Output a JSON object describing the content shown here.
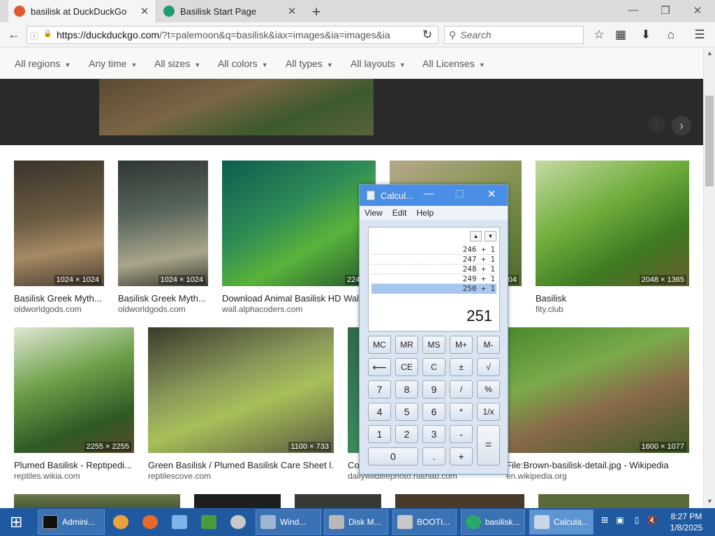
{
  "tabs": [
    {
      "label": "basilisk at DuckDuckGo",
      "close": "✕"
    },
    {
      "label": "Basilisk Start Page",
      "close": "✕"
    }
  ],
  "newtab": "+",
  "window_controls": {
    "minimize": "—",
    "restore": "❐",
    "close": "✕"
  },
  "nav": {
    "back": "←",
    "info": "ⓘ",
    "lock": "🔒",
    "url_host": "https://duckduckgo.com",
    "url_path": "/?t=palemoon&q=basilisk&iax=images&ia=images&ia",
    "reload": "↻",
    "search_placeholder": "Search",
    "search_icon": "⚲",
    "bookmark": "☆",
    "library": "▦",
    "download": "⬇",
    "home": "⌂",
    "menu": "☰"
  },
  "filters": [
    "All regions",
    "Any time",
    "All sizes",
    "All colors",
    "All types",
    "All layouts",
    "All Licenses"
  ],
  "filter_caret": "▼",
  "detail": {
    "prev": "‹",
    "next": "›"
  },
  "results_row1": [
    {
      "dims": "1024 × 1024",
      "title": "Basilisk Greek Myth...",
      "source": "oldworldgods.com"
    },
    {
      "dims": "1024 × 1024",
      "title": "Basilisk Greek Myth...",
      "source": "oldworldgods.com"
    },
    {
      "dims": "2240 ×",
      "title": "Download Animal Basilisk HD Wall",
      "source": "wall.alphacoders.com"
    },
    {
      "dims": "304",
      "title": "",
      "source": ""
    },
    {
      "dims": "2048 × 1365",
      "title": "Basilisk",
      "source": "fity.club"
    }
  ],
  "results_row2": [
    {
      "dims": "2255 × 2255",
      "title": "Plumed Basilisk - Reptipedi...",
      "source": "reptiles.wikia.com"
    },
    {
      "dims": "1100 × 733",
      "title": "Green Basilisk / Plumed Basilisk Care Sheet l...",
      "source": "reptilescove.com"
    },
    {
      "dims": "",
      "title": "Co",
      "source": "dailywildlifephoto.nathab.com"
    },
    {
      "dims": "1600 × 1077",
      "title": "File:Brown-basilisk-detail.jpg - Wikipedia",
      "source": "en.wikipedia.org"
    }
  ],
  "scrollbar": {
    "up": "▲",
    "down": "▼"
  },
  "calculator": {
    "title": "Calcul...",
    "controls": {
      "minimize": "—",
      "maximize": "☐",
      "close": "✕"
    },
    "menu": [
      "View",
      "Edit",
      "Help"
    ],
    "history_up": "▲",
    "history_down": "▼",
    "history": [
      "246 + 1",
      "247 + 1",
      "248 + 1",
      "249 + 1",
      "250 + 1"
    ],
    "result": "251",
    "buttons": [
      [
        "MC",
        "MR",
        "MS",
        "M+",
        "M-"
      ],
      [
        "⟵",
        "CE",
        "C",
        "±",
        "√"
      ],
      [
        "7",
        "8",
        "9",
        "/",
        "%"
      ],
      [
        "4",
        "5",
        "6",
        "*",
        "1/x"
      ],
      [
        "1",
        "2",
        "3",
        "-"
      ],
      [
        "0",
        ".",
        "+"
      ]
    ],
    "equals": "="
  },
  "taskbar": {
    "start": "⊞",
    "items": [
      {
        "label": "Admini...",
        "color": "#111111"
      },
      {
        "label": "",
        "color": "#e8a33c"
      },
      {
        "label": "",
        "color": "#e66a2c"
      },
      {
        "label": "",
        "color": "#7fb4e8"
      },
      {
        "label": "",
        "color": "#4c9a3c"
      },
      {
        "label": "",
        "color": "#c8c8c8"
      },
      {
        "label": "Wind...",
        "color": "#9fb6d0"
      },
      {
        "label": "Disk M...",
        "color": "#b8b8b8"
      },
      {
        "label": "BOOTI...",
        "color": "#c8c8c8"
      },
      {
        "label": "basilisk...",
        "color": "#2aa86c"
      },
      {
        "label": "Calcula...",
        "color": "#c8d6e8"
      }
    ],
    "time": "8:27 PM",
    "date": "1/8/2025"
  }
}
